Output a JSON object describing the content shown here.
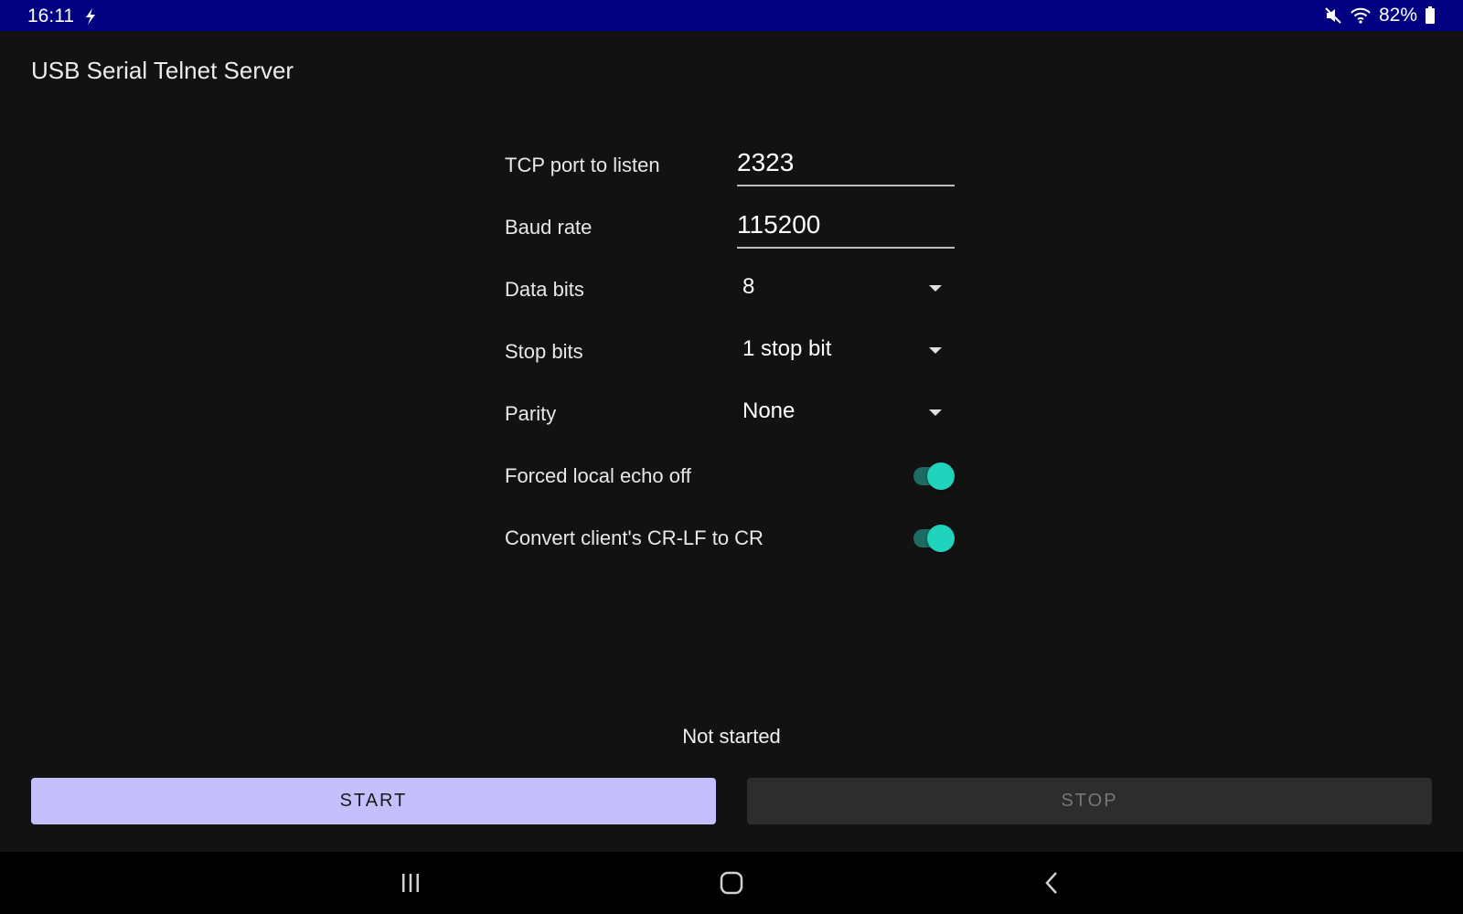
{
  "status_bar": {
    "time": "16:11",
    "battery": "82%",
    "icons": [
      "charging-icon",
      "mute-icon",
      "wifi-icon",
      "battery-icon"
    ]
  },
  "app": {
    "title": "USB Serial Telnet Server"
  },
  "form": {
    "tcp_port": {
      "label": "TCP port to listen",
      "value": "2323"
    },
    "baud_rate": {
      "label": "Baud rate",
      "value": "115200"
    },
    "data_bits": {
      "label": "Data bits",
      "selected": "8"
    },
    "stop_bits": {
      "label": "Stop bits",
      "selected": "1 stop bit"
    },
    "parity": {
      "label": "Parity",
      "selected": "None"
    },
    "local_echo": {
      "label": "Forced local echo off",
      "checked": true
    },
    "crlf": {
      "label": "Convert client's CR-LF to CR",
      "checked": true
    }
  },
  "status": {
    "text": "Not started"
  },
  "buttons": {
    "start": "START",
    "stop": "STOP"
  },
  "nav": {
    "icons": [
      "recents-icon",
      "home-icon",
      "back-icon"
    ]
  },
  "colors": {
    "status_bar": "#000080",
    "background": "#121212",
    "accent": "#1fd3bd",
    "start_button": "#c5c0fd",
    "stop_button": "#2d2d2d"
  }
}
